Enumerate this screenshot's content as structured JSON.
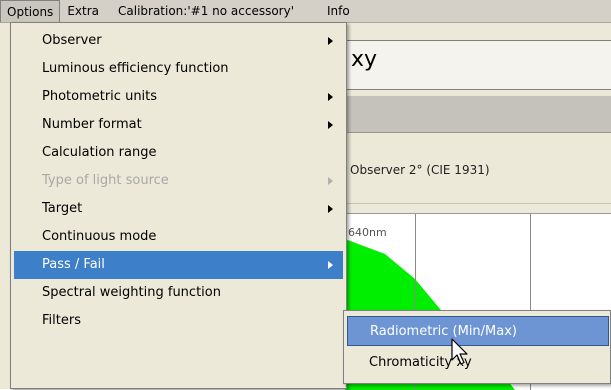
{
  "menubar": {
    "options": "Options",
    "extra": "Extra",
    "calibration": "Calibration:'#1  no accessory'",
    "info": "Info"
  },
  "options_menu": {
    "items": [
      {
        "label": "Observer",
        "submenu": true,
        "enabled": true
      },
      {
        "label": "Luminous efficiency function",
        "submenu": false,
        "enabled": true
      },
      {
        "label": "Photometric units",
        "submenu": true,
        "enabled": true
      },
      {
        "label": "Number format",
        "submenu": true,
        "enabled": true
      },
      {
        "label": "Calculation range",
        "submenu": false,
        "enabled": true
      },
      {
        "label": "Type of light source",
        "submenu": true,
        "enabled": false
      },
      {
        "label": "Target",
        "submenu": true,
        "enabled": true
      },
      {
        "label": "Continuous mode",
        "submenu": false,
        "enabled": true
      },
      {
        "label": "Pass / Fail",
        "submenu": true,
        "enabled": true,
        "highlighted": true
      },
      {
        "label": "Spectral weighting function",
        "submenu": false,
        "enabled": true
      },
      {
        "label": "Filters",
        "submenu": false,
        "enabled": true
      }
    ]
  },
  "pass_fail_submenu": {
    "items": [
      {
        "label": "Radiometric (Min/Max)",
        "highlighted": true
      },
      {
        "label": "Chromaticity xy"
      }
    ]
  },
  "background": {
    "title": "xy",
    "observer": "Observer 2° (CIE 1931)",
    "chart_label": "640nm"
  },
  "colors": {
    "menubar": "#d4d0c8",
    "menu_bg": "#ece9d8",
    "highlight": "#3d7fc8",
    "submenu_highlight": "#6d95d4",
    "chart_fill": "#00ee00"
  }
}
